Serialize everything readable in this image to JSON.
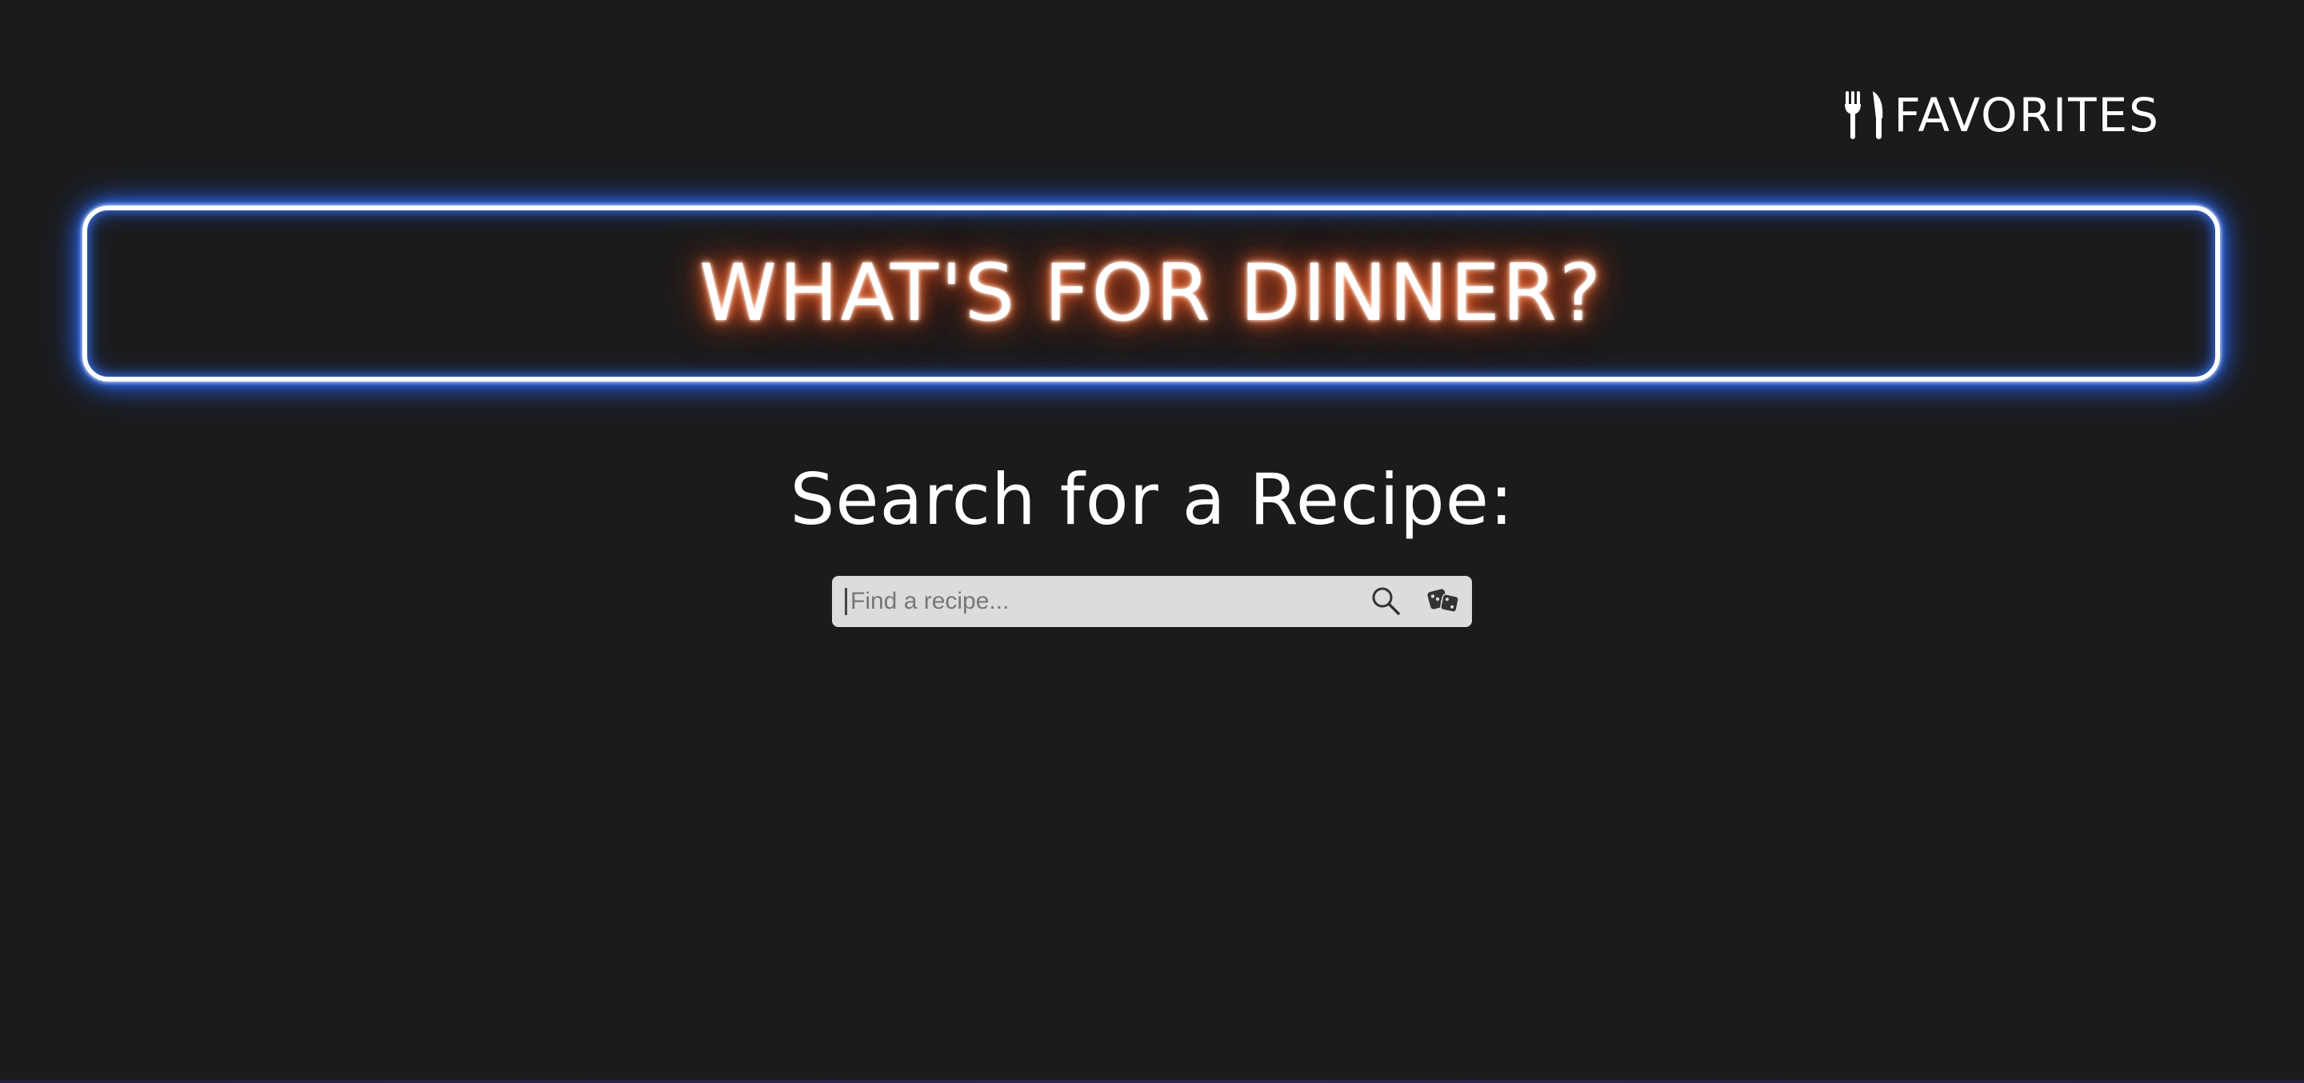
{
  "header": {
    "favorites_icon": "fork-knife-icon",
    "favorites_label": "FAVORITES"
  },
  "banner": {
    "title": "WHAT'S FOR DINNER?",
    "glow_colors": {
      "border": "#3b7dff",
      "text": "#ff6a2a"
    }
  },
  "search": {
    "heading": "Search for a Recipe:",
    "placeholder": "Find a recipe...",
    "value": "",
    "search_icon": "search-icon",
    "random_icon": "dice-icon"
  },
  "colors": {
    "background": "#1b1b1b",
    "search_bar": "#dcdcdc",
    "text": "#ffffff"
  }
}
